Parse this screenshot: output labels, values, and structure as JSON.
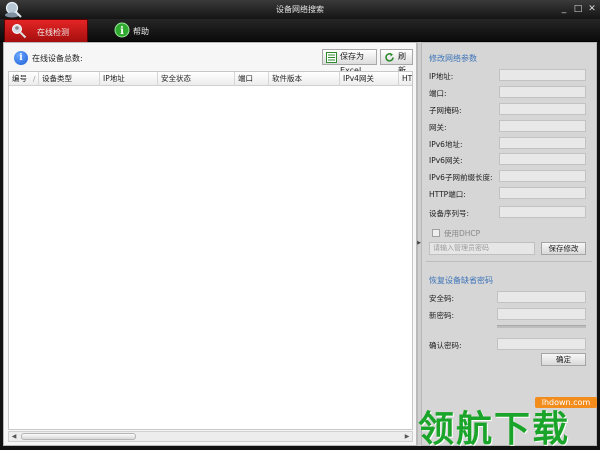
{
  "window": {
    "title": "设备网络搜索",
    "controls": [
      "_",
      "□",
      "✕"
    ]
  },
  "tabs": [
    {
      "label": "在线检测",
      "active": true,
      "icon": "search-person-icon"
    },
    {
      "label": "帮助",
      "active": false,
      "icon": "info-icon"
    }
  ],
  "left": {
    "online_count_label": "在线设备总数:",
    "export_label": "保存为Excel",
    "refresh_label": "刷新",
    "columns": [
      "编号",
      "设备类型",
      "IP地址",
      "安全状态",
      "端口",
      "软件版本",
      "IPv4网关",
      "HTT"
    ],
    "sort_mark": "/"
  },
  "right": {
    "modify_title": "修改网络参数",
    "fields": [
      {
        "label": "IP地址:",
        "value": ""
      },
      {
        "label": "端口:",
        "value": ""
      },
      {
        "label": "子网掩码:",
        "value": ""
      },
      {
        "label": "网关:",
        "value": ""
      },
      {
        "label": "IPv6地址:",
        "value": ""
      },
      {
        "label": "IPv6网关:",
        "value": ""
      },
      {
        "label": "IPv6子网前缀长度:",
        "value": ""
      },
      {
        "label": "HTTP端口:",
        "value": ""
      },
      {
        "label": "设备序列号:",
        "value": ""
      }
    ],
    "dhcp_label": "使用DHCP",
    "admin_pwd_placeholder": "请输入管理员密码",
    "save_label": "保存修改",
    "restore_title": "恢复设备缺省密码",
    "restore_fields": [
      {
        "label": "安全码:",
        "value": ""
      },
      {
        "label": "新密码:",
        "value": ""
      },
      {
        "label": "确认密码:",
        "value": ""
      }
    ],
    "confirm_label": "确定"
  },
  "watermark": {
    "site": "lhdown.com",
    "text": "领航下载"
  }
}
